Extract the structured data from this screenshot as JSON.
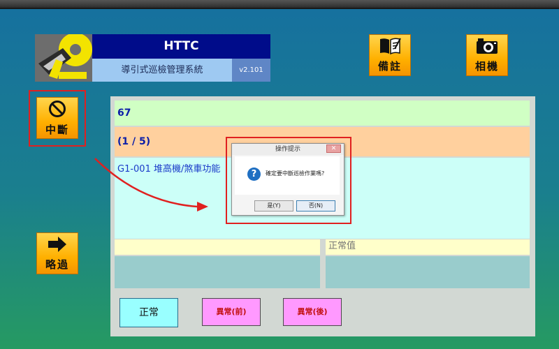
{
  "header": {
    "title": "HTTC",
    "subtitle": "導引式巡檢管理系統",
    "version": "v2.101"
  },
  "buttons": {
    "notes": "備註",
    "camera": "相機",
    "abort": "中斷",
    "skip": "略過"
  },
  "inspection": {
    "number": "67",
    "progress": "(1 / 5)",
    "item": "G1-001 堆高機/煞車功能",
    "normal_value_label": "正常值"
  },
  "actions": {
    "normal": "正常",
    "abnormal_before": "異常(前)",
    "abnormal_after": "異常(後)"
  },
  "dialog": {
    "title": "操作提示",
    "close": "✕",
    "message": "確定要中斷巡檢作業嗎?",
    "yes": "是(Y)",
    "no": "否(N)"
  },
  "colors": {
    "accent_red": "#e02020",
    "title_blue": "#000c8a",
    "button_orange": "#ffb000"
  }
}
